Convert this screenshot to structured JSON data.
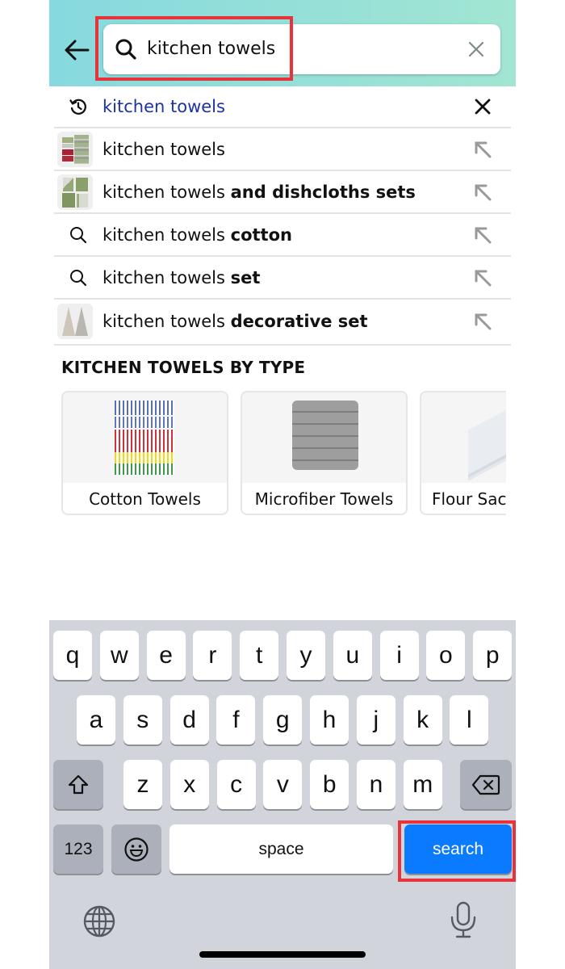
{
  "header": {
    "back_icon": "arrow-left-icon",
    "search": {
      "icon": "search-icon",
      "value": "kitchen towels",
      "clear_icon": "close-icon"
    }
  },
  "suggestions": [
    {
      "type": "history",
      "lead_icon": "history-icon",
      "text": "kitchen towels",
      "bold": "",
      "trail_icon": "remove-x-icon"
    },
    {
      "type": "image",
      "thumb": "striped-towels-thumbnail",
      "text": "kitchen towels",
      "bold": "",
      "trail_icon": "fill-query-arrow-icon"
    },
    {
      "type": "image",
      "thumb": "green-dishcloth-set-thumbnail",
      "text": "kitchen towels ",
      "bold": "and dishcloths sets",
      "trail_icon": "fill-query-arrow-icon"
    },
    {
      "type": "search",
      "lead_icon": "search-icon",
      "text": "kitchen towels ",
      "bold": "cotton",
      "trail_icon": "fill-query-arrow-icon"
    },
    {
      "type": "search",
      "lead_icon": "search-icon",
      "text": "kitchen towels ",
      "bold": "set",
      "trail_icon": "fill-query-arrow-icon"
    },
    {
      "type": "image",
      "thumb": "hanging-decorative-towels-thumbnail",
      "text": "kitchen towels ",
      "bold": "decorative set",
      "trail_icon": "fill-query-arrow-icon"
    }
  ],
  "section": {
    "title": "KITCHEN TOWELS BY TYPE",
    "cards": [
      {
        "label": "Cotton Towels",
        "image": "checkered-cotton-towel-stack"
      },
      {
        "label": "Microfiber Towels",
        "image": "gray-microfiber-towel-stack"
      },
      {
        "label": "Flour Sac",
        "image": "white-flour-sack-towels"
      }
    ]
  },
  "keyboard": {
    "row1": [
      "q",
      "w",
      "e",
      "r",
      "t",
      "y",
      "u",
      "i",
      "o",
      "p"
    ],
    "row2": [
      "a",
      "s",
      "d",
      "f",
      "g",
      "h",
      "j",
      "k",
      "l"
    ],
    "row3": [
      "z",
      "x",
      "c",
      "v",
      "b",
      "n",
      "m"
    ],
    "numbers_label": "123",
    "space_label": "space",
    "action_label": "search",
    "shift_icon": "shift-icon",
    "delete_icon": "backspace-icon",
    "emoji_icon": "emoji-icon",
    "globe_icon": "globe-icon",
    "mic_icon": "microphone-icon"
  },
  "colors": {
    "header_gradient_start": "#86d9df",
    "header_gradient_end": "#a2e5d2",
    "history_text": "#1b33a6",
    "search_key": "#0a7aff",
    "highlight_box": "#e8333a",
    "keyboard_bg": "#d1d4db"
  }
}
